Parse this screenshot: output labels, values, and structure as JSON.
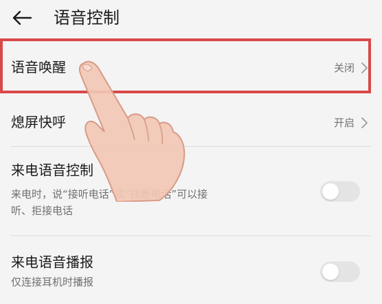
{
  "header": {
    "back_icon": "arrow-left-icon",
    "title": "语音控制"
  },
  "settings": {
    "voice_wakeup": {
      "label": "语音唤醒",
      "value": "关闭",
      "icon": "chevron-right-icon"
    },
    "screen_off_call": {
      "label": "熄屏快呼",
      "value": "开启",
      "icon": "chevron-right-icon"
    },
    "incoming_call_control": {
      "label": "来电语音控制",
      "description_line1": "来电时，说“接听电话”或“挂断电话”可以接",
      "description_line2": "听、拒接电话",
      "enabled": false
    },
    "incoming_call_announce": {
      "label": "来电语音播报",
      "description": "仅连接耳机时播报",
      "enabled": false
    }
  },
  "overlay": {
    "highlight_color": "#d94848",
    "pointer": "hand-pointer-icon"
  },
  "colors": {
    "background": "#f4f4f4",
    "toggle_off": "#e4e4e4"
  }
}
